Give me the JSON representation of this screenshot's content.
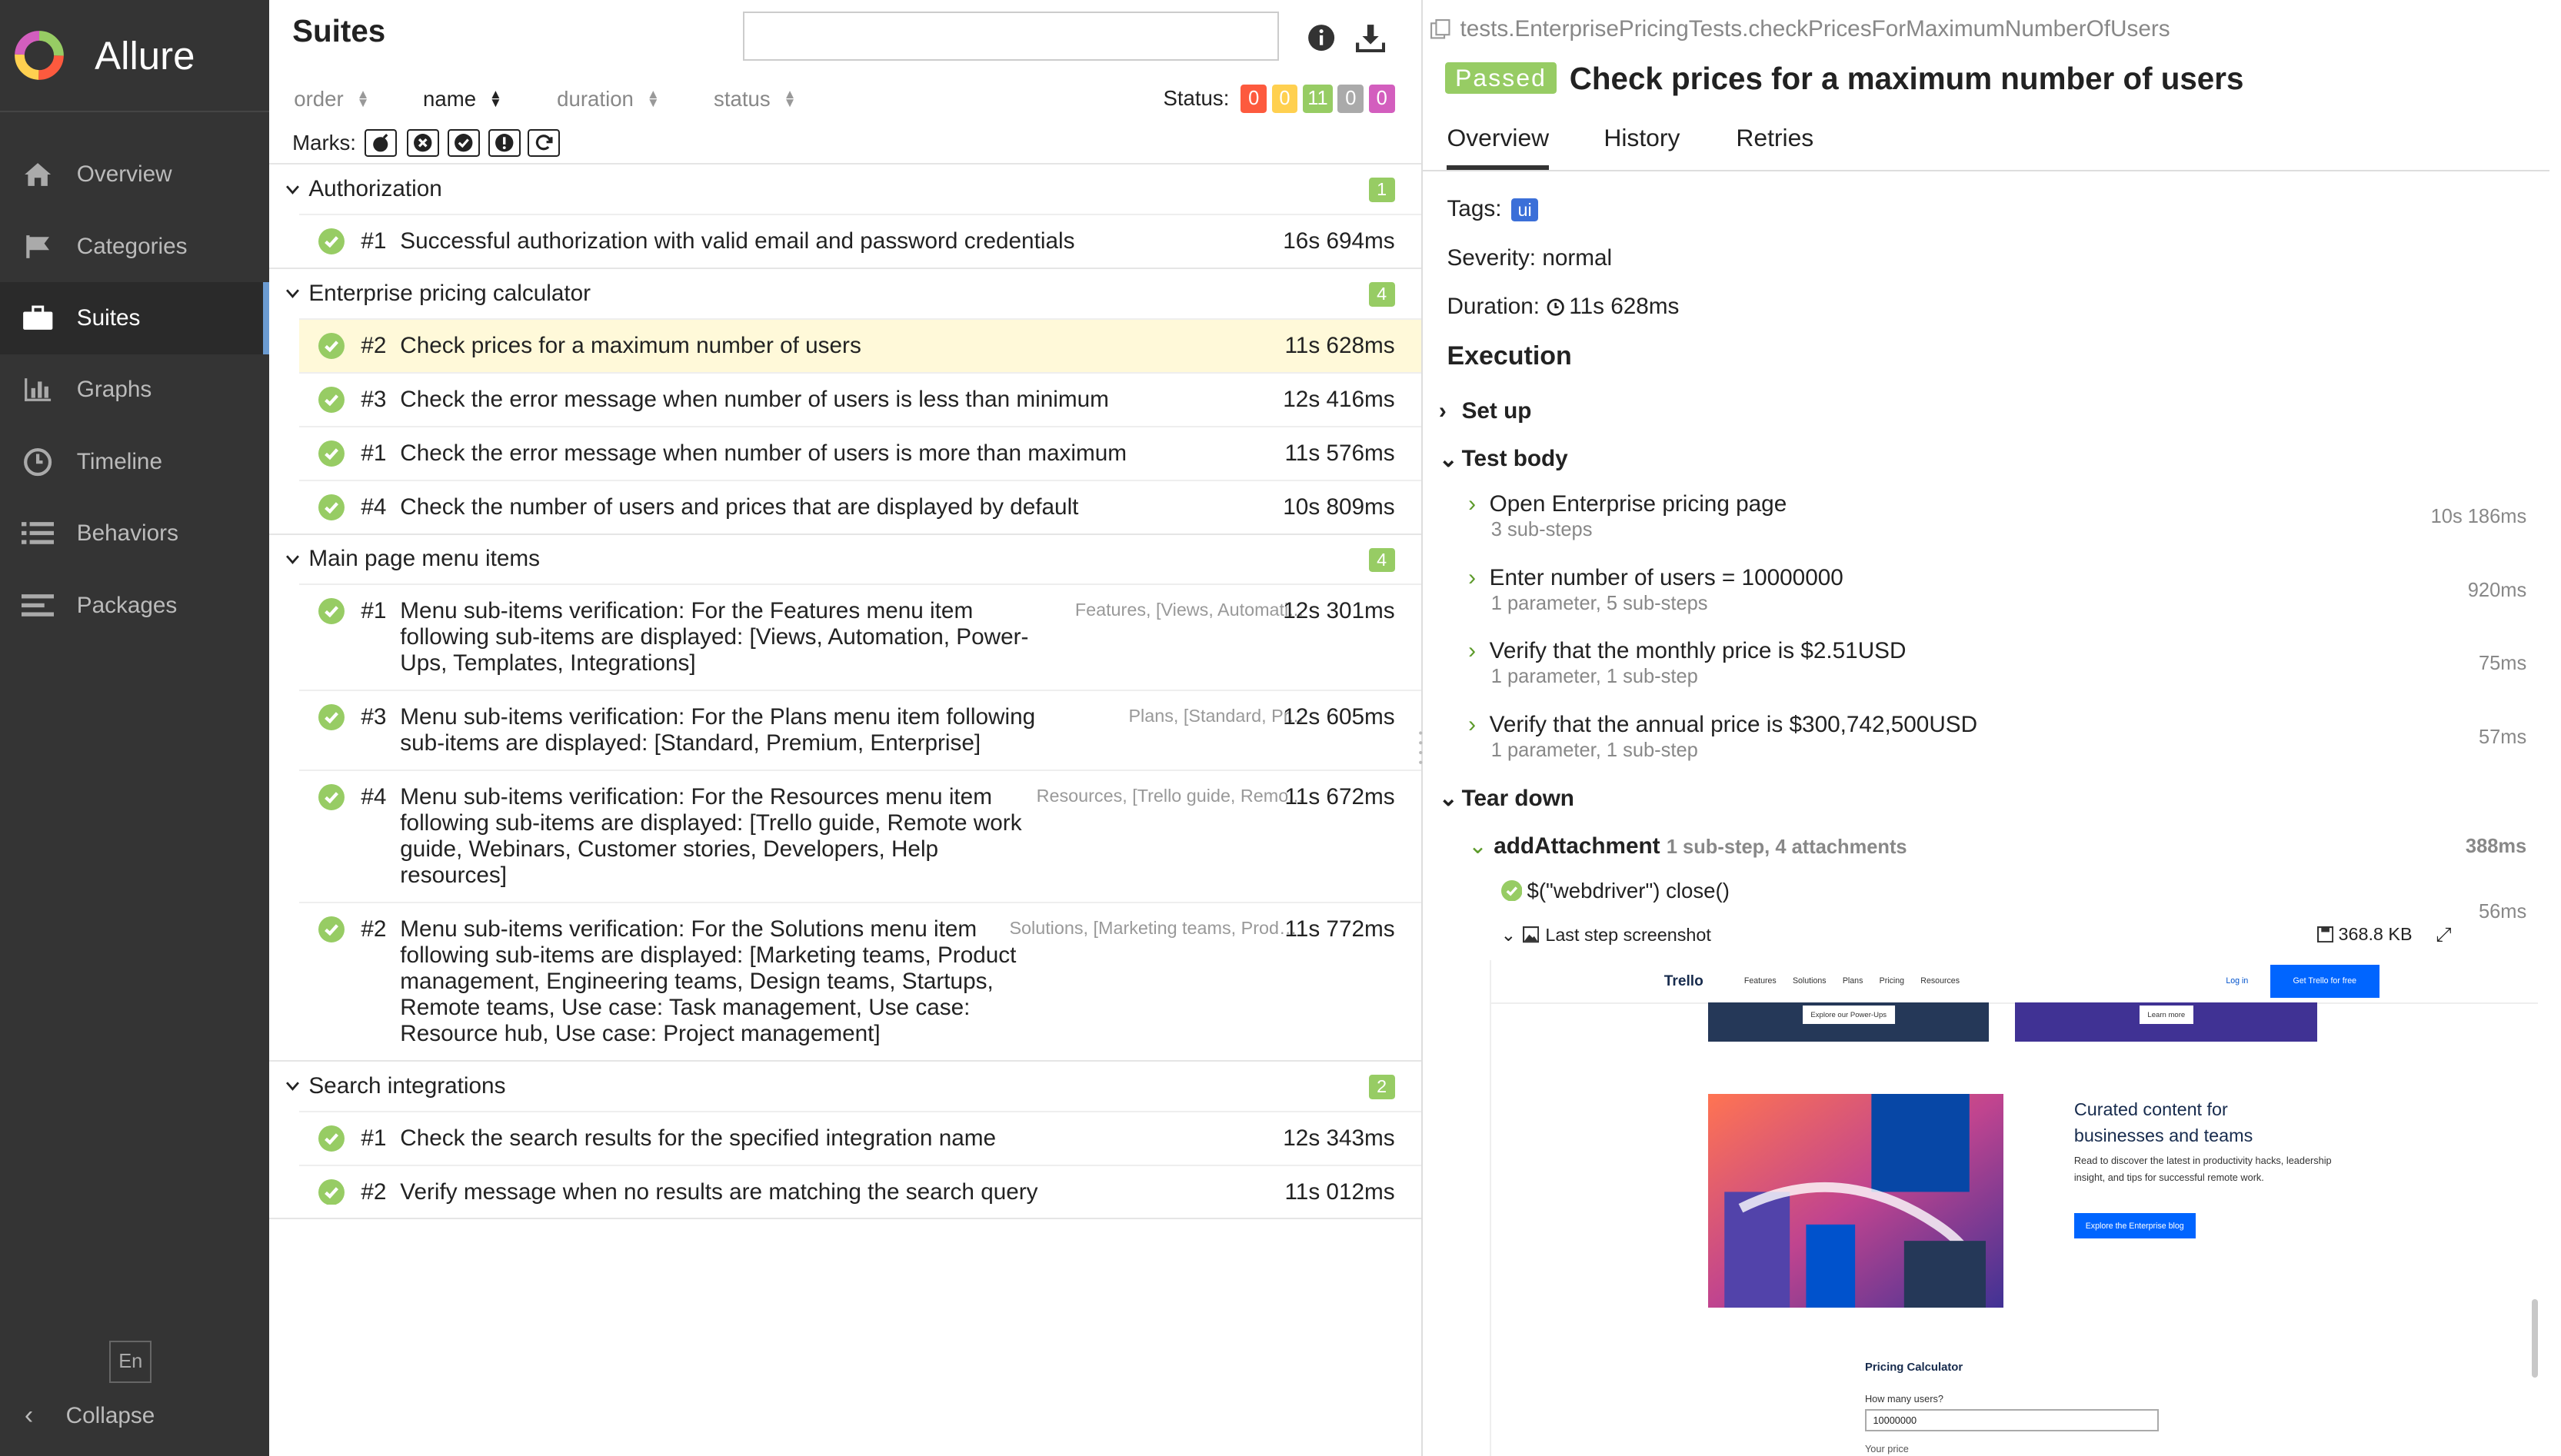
{
  "app": {
    "name": "Allure"
  },
  "sidebar": {
    "items": [
      {
        "label": "Overview",
        "icon": "home-icon"
      },
      {
        "label": "Categories",
        "icon": "flag-icon"
      },
      {
        "label": "Suites",
        "icon": "briefcase-icon",
        "active": true
      },
      {
        "label": "Graphs",
        "icon": "bar-chart-icon"
      },
      {
        "label": "Timeline",
        "icon": "clock-icon"
      },
      {
        "label": "Behaviors",
        "icon": "list-icon"
      },
      {
        "label": "Packages",
        "icon": "align-left-icon"
      }
    ],
    "language": "En",
    "collapse": "Collapse"
  },
  "suites": {
    "title": "Suites",
    "sort": {
      "order": "order",
      "name": "name",
      "duration": "duration",
      "status": "status"
    },
    "status_label": "Status:",
    "status_counts": [
      {
        "value": "0",
        "color": "#fd5a3e"
      },
      {
        "value": "0",
        "color": "#ffd050"
      },
      {
        "value": "11",
        "color": "#97cc64"
      },
      {
        "value": "0",
        "color": "#aaaaaa"
      },
      {
        "value": "0",
        "color": "#d35ebe"
      }
    ],
    "marks_label": "Marks:",
    "groups": [
      {
        "name": "Authorization",
        "count": "1",
        "rows": [
          {
            "num": "#1",
            "name": "Successful authorization with valid email and password credentials",
            "params": "",
            "duration": "16s 694ms"
          }
        ]
      },
      {
        "name": "Enterprise pricing calculator",
        "count": "4",
        "rows": [
          {
            "num": "#2",
            "name": "Check prices for a maximum number of users",
            "params": "",
            "duration": "11s 628ms",
            "selected": true
          },
          {
            "num": "#3",
            "name": "Check the error message when number of users is less than minimum",
            "params": "",
            "duration": "12s 416ms"
          },
          {
            "num": "#1",
            "name": "Check the error message when number of users is more than maximum",
            "params": "",
            "duration": "11s 576ms"
          },
          {
            "num": "#4",
            "name": "Check the number of users and prices that are displayed by default",
            "params": "",
            "duration": "10s 809ms"
          }
        ]
      },
      {
        "name": "Main page menu items",
        "count": "4",
        "rows": [
          {
            "num": "#1",
            "name": "Menu sub-items verification: For the Features menu item following sub-items are displayed: [Views, Automation, Power-Ups, Templates, Integrations]",
            "params": "Features, [Views, Automati...",
            "duration": "12s 301ms"
          },
          {
            "num": "#3",
            "name": "Menu sub-items verification: For the Plans menu item following sub-items are displayed: [Standard, Premium, Enterprise]",
            "params": "Plans, [Standard, Pr...",
            "duration": "12s 605ms"
          },
          {
            "num": "#4",
            "name": "Menu sub-items verification: For the Resources menu item following sub-items are displayed: [Trello guide, Remote work guide, Webinars, Customer stories, Developers, Help resources]",
            "params": "Resources, [Trello guide, Remo...",
            "duration": "11s 672ms"
          },
          {
            "num": "#2",
            "name": "Menu sub-items verification: For the Solutions menu item following sub-items are displayed: [Marketing teams, Product management, Engineering teams, Design teams, Startups, Remote teams, Use case: Task management, Use case: Resource hub, Use case: Project management]",
            "params": "Solutions, [Marketing teams, Product ...",
            "duration": "11s 772ms"
          }
        ]
      },
      {
        "name": "Search integrations",
        "count": "2",
        "rows": [
          {
            "num": "#1",
            "name": "Check the search results for the specified integration name",
            "params": "",
            "duration": "12s 343ms"
          },
          {
            "num": "#2",
            "name": "Verify message when no results are matching the search query",
            "params": "",
            "duration": "11s 012ms"
          }
        ]
      }
    ]
  },
  "detail": {
    "full_name": "tests.EnterprisePricingTests.checkPricesForMaximumNumberOfUsers",
    "status": "Passed",
    "title": "Check prices for a maximum number of users",
    "tabs": [
      "Overview",
      "History",
      "Retries"
    ],
    "tags_label": "Tags:",
    "tag": "ui",
    "severity": "Severity: normal",
    "duration_label": "Duration:",
    "duration": "11s 628ms",
    "execution": "Execution",
    "setup": "Set up",
    "test_body": "Test body",
    "steps": [
      {
        "name": "Open Enterprise pricing page",
        "sub": "3 sub-steps",
        "duration": "10s 186ms"
      },
      {
        "name": "Enter number of users = 10000000",
        "sub": "1 parameter, 5 sub-steps",
        "duration": "920ms"
      },
      {
        "name": "Verify that the monthly price is $2.51USD",
        "sub": "1 parameter, 1 sub-step",
        "duration": "75ms"
      },
      {
        "name": "Verify that the annual price is $300,742,500USD",
        "sub": "1 parameter, 1 sub-step",
        "duration": "57ms"
      }
    ],
    "tear_down": "Tear down",
    "attach_step": {
      "name": "addAttachment",
      "info": "1 sub-step, 4 attachments",
      "duration": "388ms"
    },
    "substep": {
      "name": "$(\"webdriver\") close()",
      "duration": "56ms"
    },
    "screenshot": {
      "name": "Last step screenshot",
      "size": "368.8 KB"
    },
    "trello": {
      "logo": "Trello",
      "links": [
        "Features",
        "Solutions",
        "Plans",
        "Pricing",
        "Resources"
      ],
      "login": "Log in",
      "cta": "Get Trello for free",
      "card_btn_1": "Explore our Power-Ups",
      "card_btn_2": "Learn more",
      "heading": "Curated content for businesses and teams",
      "para": "Read to discover the latest in productivity hacks, leadership insight, and tips for successful remote work.",
      "btn": "Explore the Enterprise blog",
      "calc_title": "Pricing Calculator",
      "calc_q": "How many users?",
      "calc_value": "10000000",
      "calc_price": "Your price"
    }
  },
  "colors": {
    "passed": "#97cc64",
    "sidebar": "#343434",
    "tag": "#3b6fd8"
  }
}
